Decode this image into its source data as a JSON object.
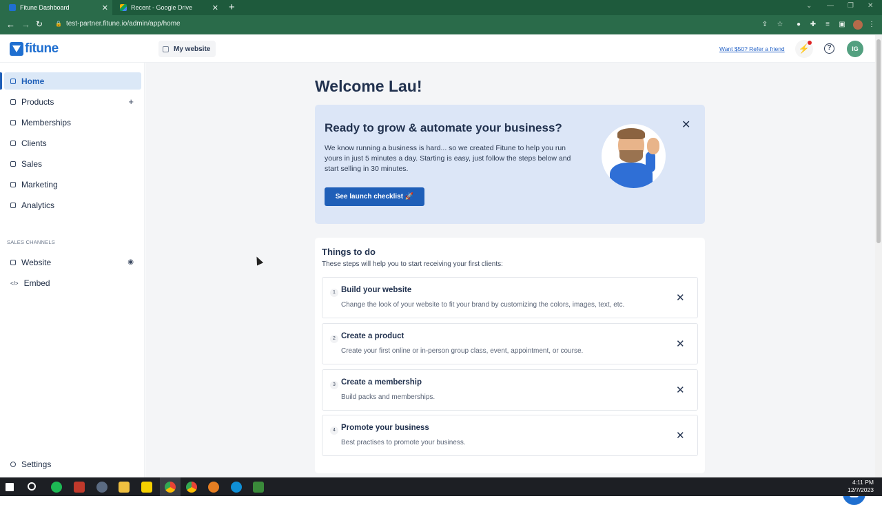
{
  "browser": {
    "tabs": [
      {
        "title": "Fitune Dashboard",
        "active": true
      },
      {
        "title": "Recent - Google Drive",
        "active": false
      }
    ],
    "url": "test-partner.fitune.io/admin/app/home"
  },
  "header": {
    "logo_text": "fitune",
    "my_website": "My website",
    "refer_link": "Want $50? Refer a friend",
    "avatar_initials": "IG"
  },
  "sidebar": {
    "items": [
      {
        "label": "Home",
        "active": true
      },
      {
        "label": "Products"
      },
      {
        "label": "Memberships"
      },
      {
        "label": "Clients"
      },
      {
        "label": "Sales"
      },
      {
        "label": "Marketing"
      },
      {
        "label": "Analytics"
      }
    ],
    "section_label": "SALES CHANNELS",
    "channels": [
      {
        "label": "Website"
      },
      {
        "label": "Embed"
      }
    ],
    "settings_label": "Settings"
  },
  "main": {
    "welcome": "Welcome Lau!",
    "hero": {
      "title": "Ready to grow & automate your business?",
      "body": "We know running a business is hard... so we created Fitune to help you run yours in just 5 minutes a day. Starting is easy, just follow the steps below and start selling in 30 minutes.",
      "button": "See launch checklist 🚀"
    },
    "todo": {
      "title": "Things to do",
      "subtitle": "These steps will help you to start receiving your first clients:",
      "steps": [
        {
          "num": "1",
          "title": "Build your website",
          "desc": "Change the look of your website to fit your brand by customizing the colors, images, text, etc."
        },
        {
          "num": "2",
          "title": "Create a product",
          "desc": "Create your first online or in-person group class, event, appointment, or course."
        },
        {
          "num": "3",
          "title": "Create a membership",
          "desc": "Build packs and memberships."
        },
        {
          "num": "4",
          "title": "Promote your business",
          "desc": "Best practises to promote your business."
        }
      ]
    }
  },
  "taskbar": {
    "time": "4:11 PM",
    "date": "12/7/2023"
  },
  "colors": {
    "brand": "#1f6fd0",
    "primary_button": "#1f5fb8",
    "chrome_green": "#2a6b4a"
  }
}
